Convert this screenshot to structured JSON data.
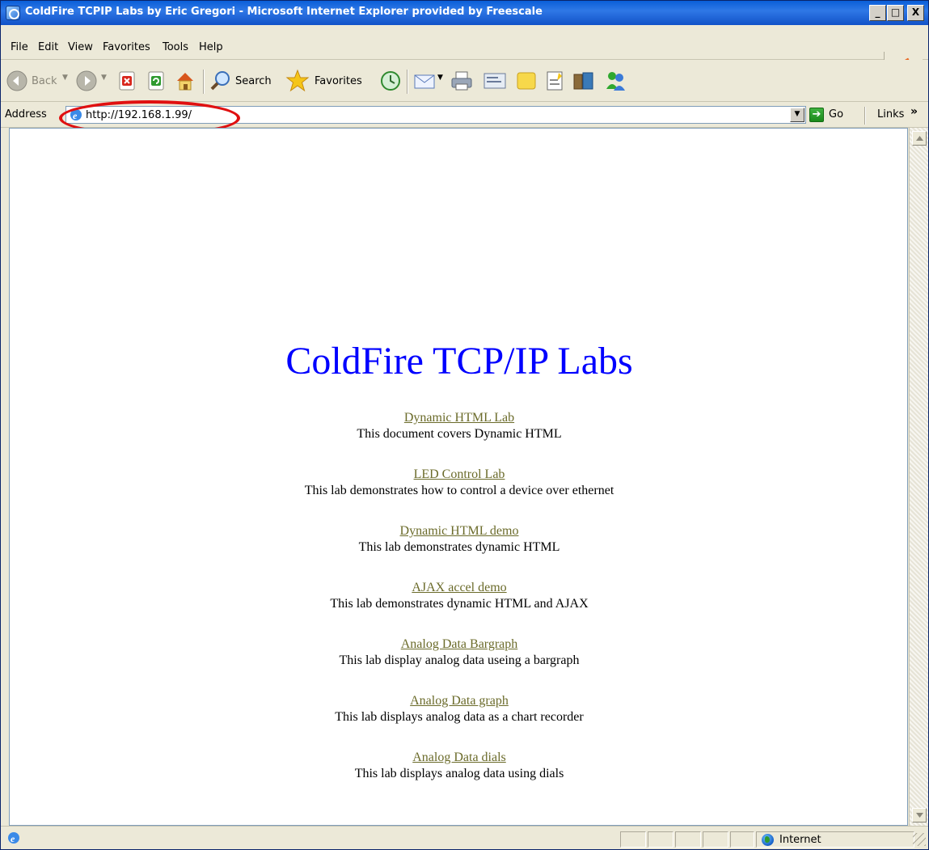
{
  "window": {
    "title": "ColdFire TCPIP Labs by Eric Gregori - Microsoft Internet Explorer provided by Freescale",
    "minimize": "_",
    "maximize": "□",
    "close": "X"
  },
  "menu": {
    "file": "File",
    "edit": "Edit",
    "view": "View",
    "favorites": "Favorites",
    "tools": "Tools",
    "help": "Help"
  },
  "toolbar": {
    "back": "Back",
    "search": "Search",
    "favorites": "Favorites"
  },
  "address_bar": {
    "label": "Address",
    "url": "http://192.168.1.99/",
    "go": "Go",
    "links": "Links",
    "links_chevron": "»"
  },
  "page": {
    "heading": "ColdFire TCP/IP Labs",
    "labs": [
      {
        "link": "Dynamic HTML Lab",
        "description": "This document covers Dynamic HTML"
      },
      {
        "link": "LED Control Lab",
        "description": "This lab demonstrates how to control a device over ethernet"
      },
      {
        "link": "Dynamic HTML demo",
        "description": "This lab demonstrates dynamic HTML"
      },
      {
        "link": "AJAX accel demo",
        "description": "This lab demonstrates dynamic HTML and AJAX"
      },
      {
        "link": "Analog Data Bargraph",
        "description": "This lab display analog data useing a bargraph"
      },
      {
        "link": "Analog Data graph",
        "description": "This lab displays analog data as a chart recorder"
      },
      {
        "link": "Analog Data dials",
        "description": "This lab displays analog data using dials"
      }
    ]
  },
  "status_bar": {
    "zone": "Internet"
  },
  "colors": {
    "heading": "#0000ff",
    "link": "#6b6b2a",
    "annotation": "#e01010",
    "titlebar": "#0a5fd8"
  },
  "icons": [
    "ie-icon",
    "back-arrow-icon",
    "forward-arrow-icon",
    "stop-icon",
    "refresh-icon",
    "home-icon",
    "search-icon",
    "favorites-star-icon",
    "history-icon",
    "mail-icon",
    "print-icon",
    "edit-icon",
    "discuss-icon",
    "research-icon",
    "media-icon",
    "messenger-icon",
    "go-arrow-icon",
    "internet-globe-icon",
    "freescale-logo-icon"
  ]
}
